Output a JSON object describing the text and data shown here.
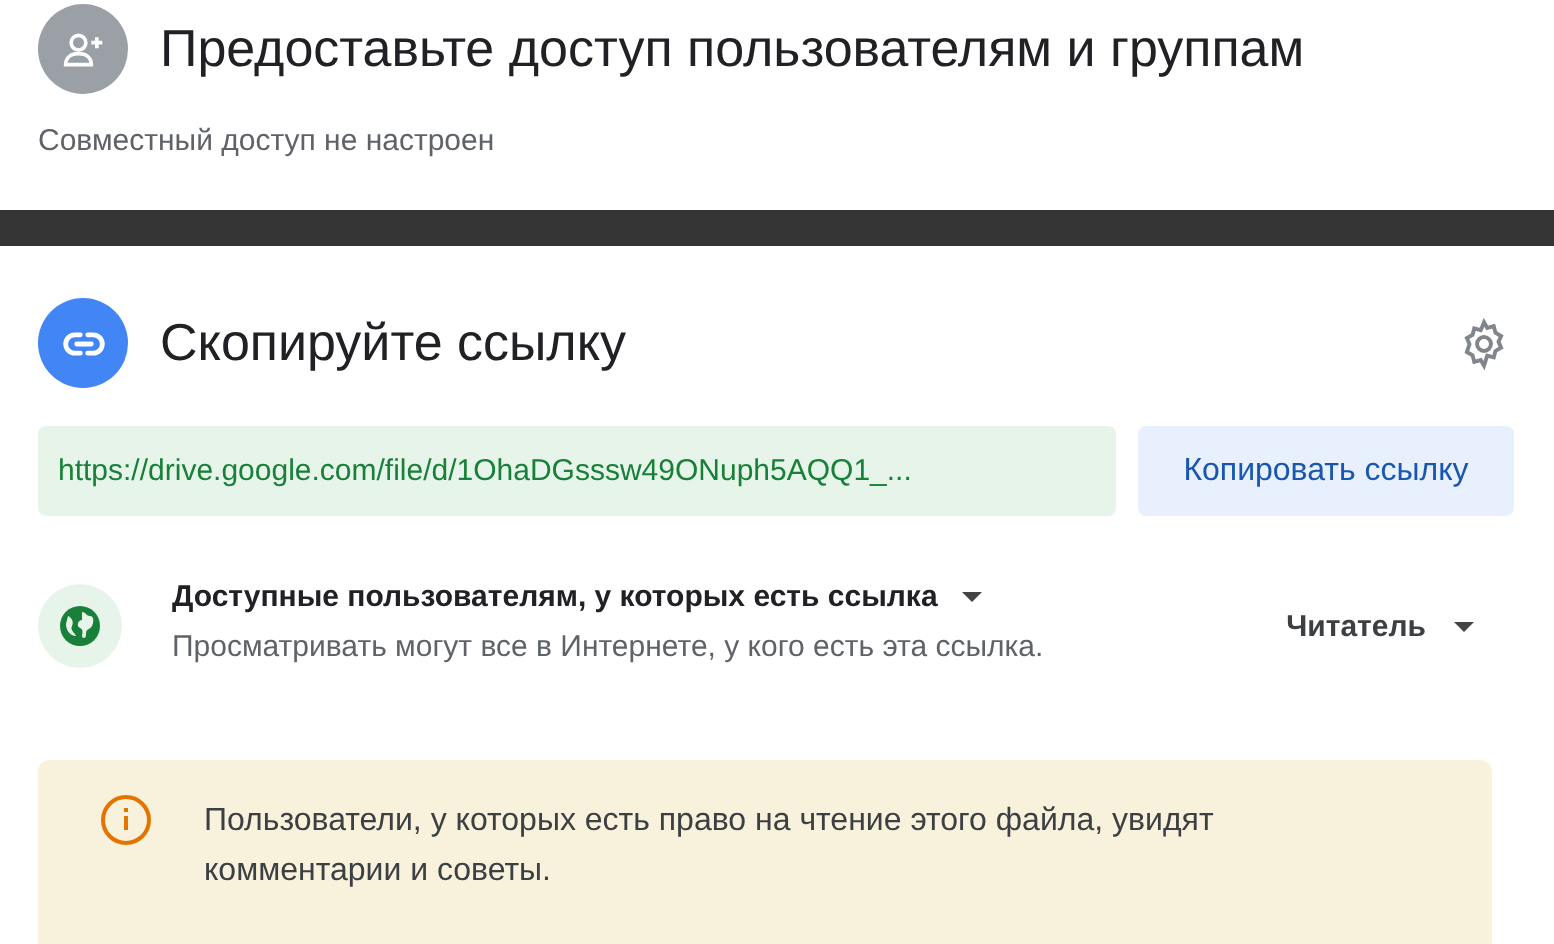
{
  "share_section": {
    "title": "Предоставьте доступ пользователям и группам",
    "status": "Совместный доступ не настроен"
  },
  "link_section": {
    "title": "Скопируйте ссылку",
    "url": "https://drive.google.com/file/d/1OhaDGsssw49ONuph5AQQ1_...",
    "copy_button": "Копировать ссылку",
    "access": {
      "title": "Доступные пользователям, у которых есть ссылка",
      "description": "Просматривать могут все в Интернете, у кого есть эта ссылка.",
      "role": "Читатель"
    }
  },
  "notice": {
    "text": "Пользователи, у которых есть право на чтение этого файла, увидят комментарии и советы."
  }
}
